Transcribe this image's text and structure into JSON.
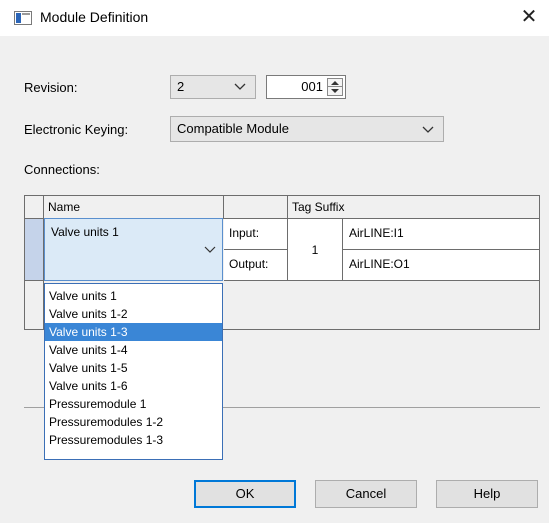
{
  "window": {
    "title": "Module Definition",
    "close_glyph": "✕"
  },
  "revision": {
    "label": "Revision:",
    "major": "2",
    "minor": "001"
  },
  "keying": {
    "label": "Electronic Keying:",
    "value": "Compatible Module"
  },
  "connections": {
    "label": "Connections:",
    "headers": {
      "name": "Name",
      "tag_suffix": "Tag Suffix"
    },
    "row": {
      "name": "Valve units 1",
      "input_label": "Input:",
      "output_label": "Output:",
      "count": "1",
      "input_tag": "AirLINE:I1",
      "output_tag": "AirLINE:O1"
    }
  },
  "dropdown": {
    "selected_index": 2,
    "options": [
      "Valve units 1",
      "Valve units 1-2",
      "Valve units 1-3",
      "Valve units 1-4",
      "Valve units 1-5",
      "Valve units 1-6",
      "Pressuremodule 1",
      "Pressuremodules 1-2",
      "Pressuremodules 1-3"
    ]
  },
  "buttons": {
    "ok": "OK",
    "cancel": "Cancel",
    "help": "Help"
  },
  "colors": {
    "accent": "#0078d7",
    "selection": "#3a86d6",
    "cell_highlight": "#dbeaf7"
  }
}
